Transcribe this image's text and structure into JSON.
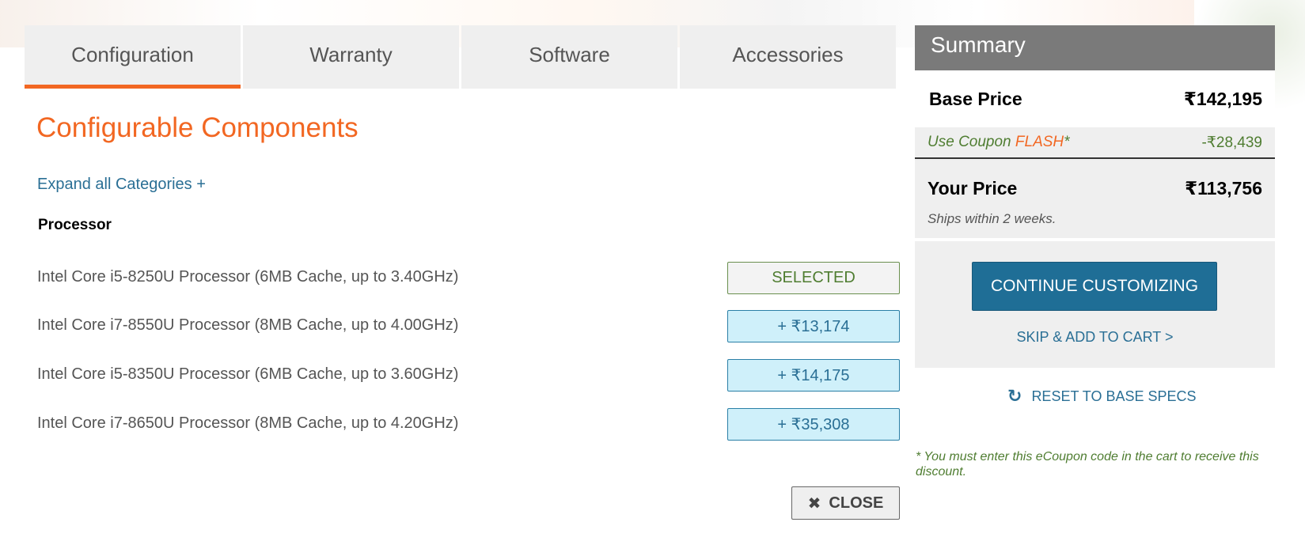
{
  "tabs": [
    {
      "label": "Configuration",
      "active": true
    },
    {
      "label": "Warranty",
      "active": false
    },
    {
      "label": "Software",
      "active": false
    },
    {
      "label": "Accessories",
      "active": false
    }
  ],
  "main": {
    "title": "Configurable Components",
    "expand_link": "Expand all Categories +",
    "category": "Processor",
    "options": [
      {
        "label": "Intel Core i5-8250U Processor (6MB Cache, up to 3.40GHz)",
        "button": "SELECTED",
        "selected": true
      },
      {
        "label": "Intel Core i7-8550U Processor (8MB Cache, up to 4.00GHz)",
        "button": "+ ₹13,174",
        "selected": false
      },
      {
        "label": "Intel Core i5-8350U Processor (6MB Cache, up to 3.60GHz)",
        "button": "+ ₹14,175",
        "selected": false
      },
      {
        "label": "Intel Core i7-8650U Processor (8MB Cache, up to 4.20GHz)",
        "button": "+ ₹35,308",
        "selected": false
      }
    ],
    "close_label": "CLOSE"
  },
  "summary": {
    "header": "Summary",
    "base_price_label": "Base Price",
    "base_price": "₹142,195",
    "coupon_prefix": "Use Coupon ",
    "coupon_code": "FLASH",
    "coupon_suffix": "*",
    "coupon_amount": "-₹28,439",
    "your_price_label": "Your Price",
    "your_price": "₹113,756",
    "ships": "Ships within 2 weeks.",
    "continue_button": "CONTINUE CUSTOMIZING",
    "skip_link": "SKIP & ADD TO CART >",
    "reset_link": "RESET TO BASE SPECS",
    "note": "* You must enter this eCoupon code in the cart to receive this discount."
  },
  "colors": {
    "accent": "#f26722",
    "link": "#2a6f95",
    "primary_button": "#1f6e96",
    "coupon_green": "#4f7d31"
  },
  "icons": {
    "close": "close-icon",
    "reset": "reset-icon"
  }
}
